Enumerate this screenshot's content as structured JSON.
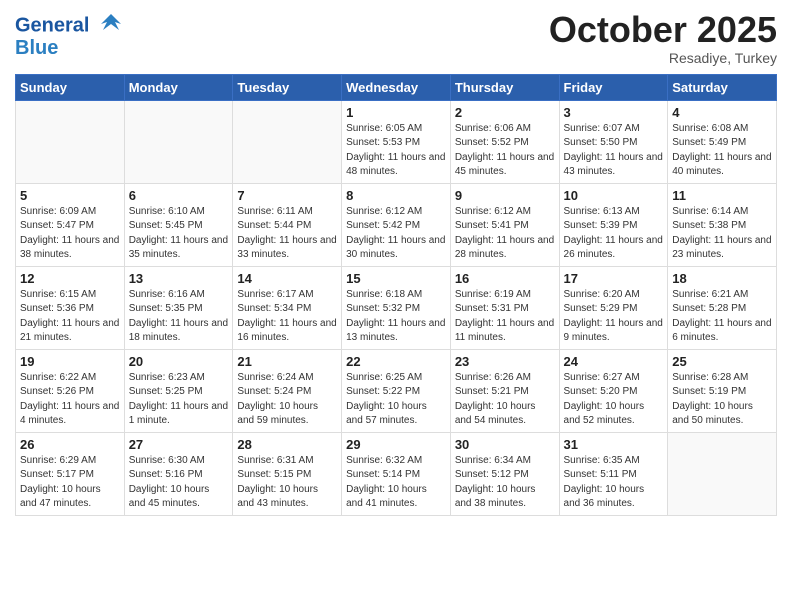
{
  "header": {
    "logo_line1": "General",
    "logo_line2": "Blue",
    "month": "October 2025",
    "location": "Resadiye, Turkey"
  },
  "weekdays": [
    "Sunday",
    "Monday",
    "Tuesday",
    "Wednesday",
    "Thursday",
    "Friday",
    "Saturday"
  ],
  "weeks": [
    [
      {
        "day": "",
        "info": ""
      },
      {
        "day": "",
        "info": ""
      },
      {
        "day": "",
        "info": ""
      },
      {
        "day": "1",
        "info": "Sunrise: 6:05 AM\nSunset: 5:53 PM\nDaylight: 11 hours\nand 48 minutes."
      },
      {
        "day": "2",
        "info": "Sunrise: 6:06 AM\nSunset: 5:52 PM\nDaylight: 11 hours\nand 45 minutes."
      },
      {
        "day": "3",
        "info": "Sunrise: 6:07 AM\nSunset: 5:50 PM\nDaylight: 11 hours\nand 43 minutes."
      },
      {
        "day": "4",
        "info": "Sunrise: 6:08 AM\nSunset: 5:49 PM\nDaylight: 11 hours\nand 40 minutes."
      }
    ],
    [
      {
        "day": "5",
        "info": "Sunrise: 6:09 AM\nSunset: 5:47 PM\nDaylight: 11 hours\nand 38 minutes."
      },
      {
        "day": "6",
        "info": "Sunrise: 6:10 AM\nSunset: 5:45 PM\nDaylight: 11 hours\nand 35 minutes."
      },
      {
        "day": "7",
        "info": "Sunrise: 6:11 AM\nSunset: 5:44 PM\nDaylight: 11 hours\nand 33 minutes."
      },
      {
        "day": "8",
        "info": "Sunrise: 6:12 AM\nSunset: 5:42 PM\nDaylight: 11 hours\nand 30 minutes."
      },
      {
        "day": "9",
        "info": "Sunrise: 6:12 AM\nSunset: 5:41 PM\nDaylight: 11 hours\nand 28 minutes."
      },
      {
        "day": "10",
        "info": "Sunrise: 6:13 AM\nSunset: 5:39 PM\nDaylight: 11 hours\nand 26 minutes."
      },
      {
        "day": "11",
        "info": "Sunrise: 6:14 AM\nSunset: 5:38 PM\nDaylight: 11 hours\nand 23 minutes."
      }
    ],
    [
      {
        "day": "12",
        "info": "Sunrise: 6:15 AM\nSunset: 5:36 PM\nDaylight: 11 hours\nand 21 minutes."
      },
      {
        "day": "13",
        "info": "Sunrise: 6:16 AM\nSunset: 5:35 PM\nDaylight: 11 hours\nand 18 minutes."
      },
      {
        "day": "14",
        "info": "Sunrise: 6:17 AM\nSunset: 5:34 PM\nDaylight: 11 hours\nand 16 minutes."
      },
      {
        "day": "15",
        "info": "Sunrise: 6:18 AM\nSunset: 5:32 PM\nDaylight: 11 hours\nand 13 minutes."
      },
      {
        "day": "16",
        "info": "Sunrise: 6:19 AM\nSunset: 5:31 PM\nDaylight: 11 hours\nand 11 minutes."
      },
      {
        "day": "17",
        "info": "Sunrise: 6:20 AM\nSunset: 5:29 PM\nDaylight: 11 hours\nand 9 minutes."
      },
      {
        "day": "18",
        "info": "Sunrise: 6:21 AM\nSunset: 5:28 PM\nDaylight: 11 hours\nand 6 minutes."
      }
    ],
    [
      {
        "day": "19",
        "info": "Sunrise: 6:22 AM\nSunset: 5:26 PM\nDaylight: 11 hours\nand 4 minutes."
      },
      {
        "day": "20",
        "info": "Sunrise: 6:23 AM\nSunset: 5:25 PM\nDaylight: 11 hours\nand 1 minute."
      },
      {
        "day": "21",
        "info": "Sunrise: 6:24 AM\nSunset: 5:24 PM\nDaylight: 10 hours\nand 59 minutes."
      },
      {
        "day": "22",
        "info": "Sunrise: 6:25 AM\nSunset: 5:22 PM\nDaylight: 10 hours\nand 57 minutes."
      },
      {
        "day": "23",
        "info": "Sunrise: 6:26 AM\nSunset: 5:21 PM\nDaylight: 10 hours\nand 54 minutes."
      },
      {
        "day": "24",
        "info": "Sunrise: 6:27 AM\nSunset: 5:20 PM\nDaylight: 10 hours\nand 52 minutes."
      },
      {
        "day": "25",
        "info": "Sunrise: 6:28 AM\nSunset: 5:19 PM\nDaylight: 10 hours\nand 50 minutes."
      }
    ],
    [
      {
        "day": "26",
        "info": "Sunrise: 6:29 AM\nSunset: 5:17 PM\nDaylight: 10 hours\nand 47 minutes."
      },
      {
        "day": "27",
        "info": "Sunrise: 6:30 AM\nSunset: 5:16 PM\nDaylight: 10 hours\nand 45 minutes."
      },
      {
        "day": "28",
        "info": "Sunrise: 6:31 AM\nSunset: 5:15 PM\nDaylight: 10 hours\nand 43 minutes."
      },
      {
        "day": "29",
        "info": "Sunrise: 6:32 AM\nSunset: 5:14 PM\nDaylight: 10 hours\nand 41 minutes."
      },
      {
        "day": "30",
        "info": "Sunrise: 6:34 AM\nSunset: 5:12 PM\nDaylight: 10 hours\nand 38 minutes."
      },
      {
        "day": "31",
        "info": "Sunrise: 6:35 AM\nSunset: 5:11 PM\nDaylight: 10 hours\nand 36 minutes."
      },
      {
        "day": "",
        "info": ""
      }
    ]
  ]
}
